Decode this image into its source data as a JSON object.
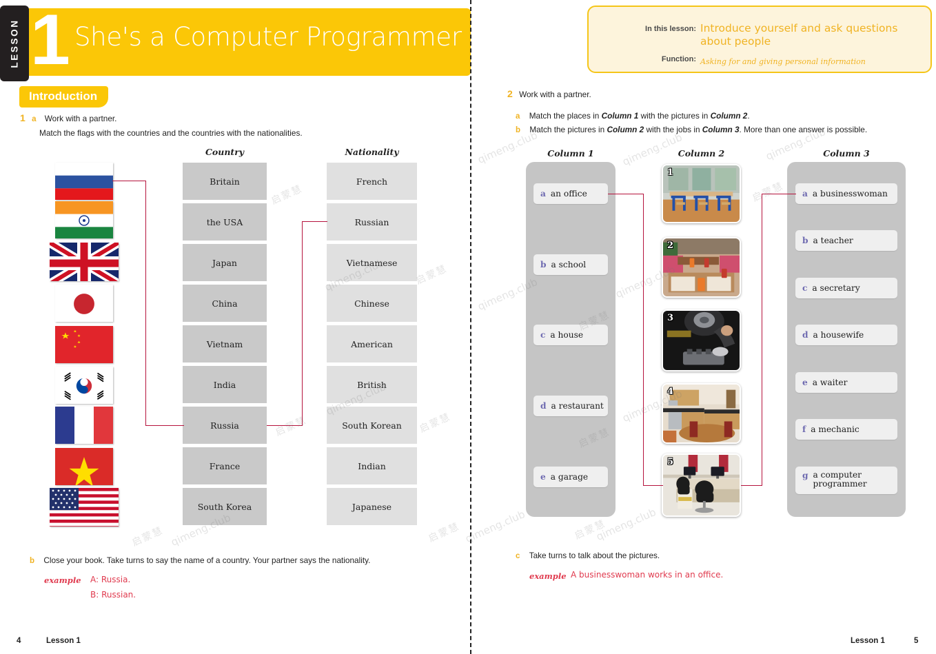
{
  "header": {
    "lesson_tab": "LESSON",
    "lesson_number": "1",
    "title": "She's a Computer Programmer",
    "info": {
      "in_this_lesson_label": "In this lesson:",
      "in_this_lesson_value": "Introduce yourself and ask questions about people",
      "function_label": "Function:",
      "function_value": "Asking for and giving personal information"
    }
  },
  "left_page": {
    "section_pill": "Introduction",
    "ex1": {
      "number": "1",
      "letter_a": "a",
      "line1": "Work with a partner.",
      "line2": "Match the flags with the countries and the countries with the nationalities.",
      "captions": {
        "country": "Country",
        "nationality": "Nationality"
      },
      "flags": [
        {
          "name": "russia-flag",
          "country": "Russia"
        },
        {
          "name": "india-flag",
          "country": "India"
        },
        {
          "name": "united-kingdom-flag",
          "country": "Britain"
        },
        {
          "name": "japan-flag",
          "country": "Japan"
        },
        {
          "name": "china-flag",
          "country": "China"
        },
        {
          "name": "south-korea-flag",
          "country": "South Korea"
        },
        {
          "name": "france-flag",
          "country": "France"
        },
        {
          "name": "vietnam-flag",
          "country": "Vietnam"
        },
        {
          "name": "usa-flag",
          "country": "the USA"
        }
      ],
      "countries": [
        "Britain",
        "the USA",
        "Japan",
        "China",
        "Vietnam",
        "India",
        "Russia",
        "France",
        "South Korea"
      ],
      "nationalities": [
        "French",
        "Russian",
        "Vietnamese",
        "Chinese",
        "American",
        "British",
        "South Korean",
        "Indian",
        "Japanese"
      ],
      "answer_line_color": "#b5123c"
    },
    "ex1b": {
      "letter": "b",
      "text": "Close your book. Take turns to say the name of a country. Your partner says the nationality.",
      "example_label": "example",
      "example_lines": [
        "A: Russia.",
        "B: Russian."
      ]
    },
    "footer": {
      "page": "4",
      "label": "Lesson 1"
    }
  },
  "right_page": {
    "ex2": {
      "number": "2",
      "title": "Work with a partner.",
      "items": [
        {
          "letter": "a",
          "pre": "Match the places in ",
          "b1": "Column 1",
          "mid": " with the pictures in ",
          "b2": "Column 2",
          "post": "."
        },
        {
          "letter": "b",
          "pre": "Match the pictures in ",
          "b1": "Column 2",
          "mid": " with the jobs in ",
          "b2": "Column 3",
          "post": ". More than one answer is possible."
        }
      ],
      "captions": {
        "c1": "Column 1",
        "c2": "Column 2",
        "c3": "Column 3"
      },
      "column1": [
        {
          "letter": "a",
          "label": "an office"
        },
        {
          "letter": "b",
          "label": "a school"
        },
        {
          "letter": "c",
          "label": "a house"
        },
        {
          "letter": "d",
          "label": "a restaurant"
        },
        {
          "letter": "e",
          "label": "a garage"
        }
      ],
      "column2": [
        {
          "number": "1",
          "name": "classroom-photo",
          "alt": "classroom with blue desks"
        },
        {
          "number": "2",
          "name": "restaurant-photo",
          "alt": "restaurant interior with tables"
        },
        {
          "number": "3",
          "name": "mechanic-photo",
          "alt": "mechanic working under a car"
        },
        {
          "number": "4",
          "name": "kitchen-photo",
          "alt": "house kitchen with dining table"
        },
        {
          "number": "5",
          "name": "office-photo",
          "alt": "office desks with computers and chairs"
        }
      ],
      "column3": [
        {
          "letter": "a",
          "label": "a businesswoman"
        },
        {
          "letter": "b",
          "label": "a teacher"
        },
        {
          "letter": "c",
          "label": "a secretary"
        },
        {
          "letter": "d",
          "label": "a housewife"
        },
        {
          "letter": "e",
          "label": "a waiter"
        },
        {
          "letter": "f",
          "label": "a mechanic"
        },
        {
          "letter": "g1",
          "label": "a computer"
        },
        {
          "letter": "g2",
          "label": "programmer"
        }
      ],
      "column3_g_letter": "g"
    },
    "ex2c": {
      "letter": "c",
      "text": "Take turns to talk about the pictures.",
      "example_label": "example",
      "example_text": "A businesswoman works in an office."
    },
    "footer": {
      "page": "5",
      "label": "Lesson 1"
    }
  },
  "watermark": {
    "cn": "启蒙慧",
    "en": "qimeng.club"
  }
}
